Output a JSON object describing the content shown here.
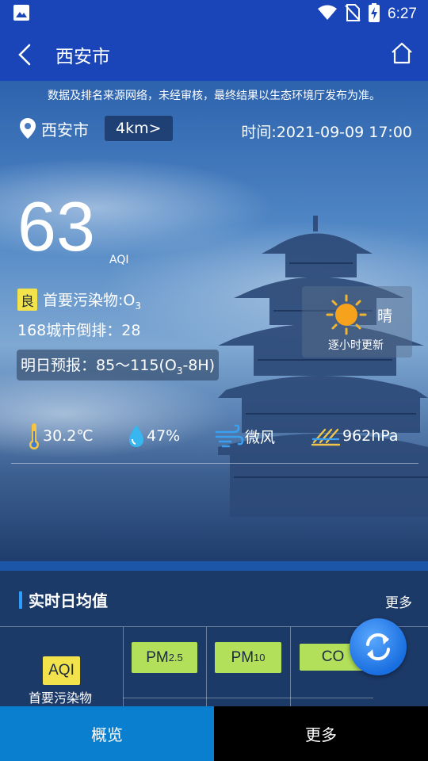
{
  "status_bar": {
    "time": "6:27"
  },
  "header": {
    "title": "西安市"
  },
  "hero": {
    "disclaimer": "数据及排名来源网络，未经审核，最终结果以生态环境厅发布为准。",
    "city": "西安市",
    "range_button": "4km>",
    "time": "时间:2021-09-09 17:00",
    "aqi_value": "63",
    "aqi_unit": "AQI",
    "level": "良",
    "primary_pollutant_prefix": "首要污染物:O",
    "primary_pollutant_sub": "3",
    "rank": "168城市倒排：28",
    "forecast_prefix": "明日预报：85～115(O",
    "forecast_sub": "3",
    "forecast_suffix": "-8H)",
    "weather": "晴",
    "weather_sub": "逐小时更新",
    "metrics": {
      "temperature": "30.2℃",
      "humidity": "47%",
      "wind": "微风",
      "pressure": "962hPa"
    }
  },
  "section": {
    "title": "实时日均值",
    "more": "更多",
    "aqi_badge": "AQI",
    "primary_label": "首要污染物",
    "pm25": {
      "main": "PM",
      "sub": "2.5"
    },
    "pm10": {
      "main": "PM",
      "sub": "10"
    },
    "co": "CO"
  },
  "bottom_nav": {
    "overview": "概览",
    "more": "更多"
  },
  "colors": {
    "header_blue": "#1a45b8",
    "good_yellow": "#f2e34c",
    "pollutant_green": "#b3e05a",
    "nav_active": "#0a7fd0"
  }
}
